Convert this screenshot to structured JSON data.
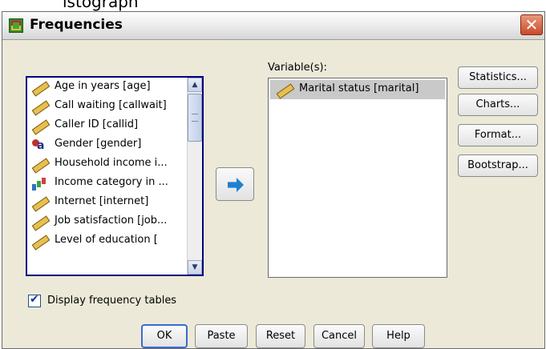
{
  "top_strip_text": "istograph",
  "window": {
    "title": "Frequencies",
    "close_glyph": "✕"
  },
  "source_list": {
    "items": [
      {
        "label": "Age in years [age]",
        "icon": "scale-ruler-icon"
      },
      {
        "label": "Call waiting [callwait]",
        "icon": "scale-ruler-icon"
      },
      {
        "label": "Caller ID [callid]",
        "icon": "scale-ruler-icon"
      },
      {
        "label": "Gender [gender]",
        "icon": "nominal-icon"
      },
      {
        "label": "Household income i...",
        "icon": "scale-ruler-icon"
      },
      {
        "label": "Income category in ...",
        "icon": "ordinal-bar-icon"
      },
      {
        "label": "Internet [internet]",
        "icon": "scale-ruler-icon"
      },
      {
        "label": "Job satisfaction [job...",
        "icon": "scale-ruler-icon"
      },
      {
        "label": "Level of education [",
        "icon": "scale-ruler-icon"
      }
    ]
  },
  "variables": {
    "label": "Variable(s):",
    "items": [
      {
        "label": "Marital status [marital]",
        "icon": "scale-ruler-icon"
      }
    ]
  },
  "side_buttons": {
    "statistics": "Statistics...",
    "charts": "Charts...",
    "format": "Format...",
    "bootstrap": "Bootstrap..."
  },
  "display_frequency": {
    "label": "Display frequency tables",
    "checked": true
  },
  "bottom_buttons": {
    "ok": "OK",
    "paste": "Paste",
    "reset": "Reset",
    "cancel": "Cancel",
    "help": "Help"
  },
  "colors": {
    "dialog_bg": "#ece9d8",
    "selected_row": "#c9c9c9",
    "arrow": "#1f7fd0",
    "listbox_border": "#000080"
  }
}
